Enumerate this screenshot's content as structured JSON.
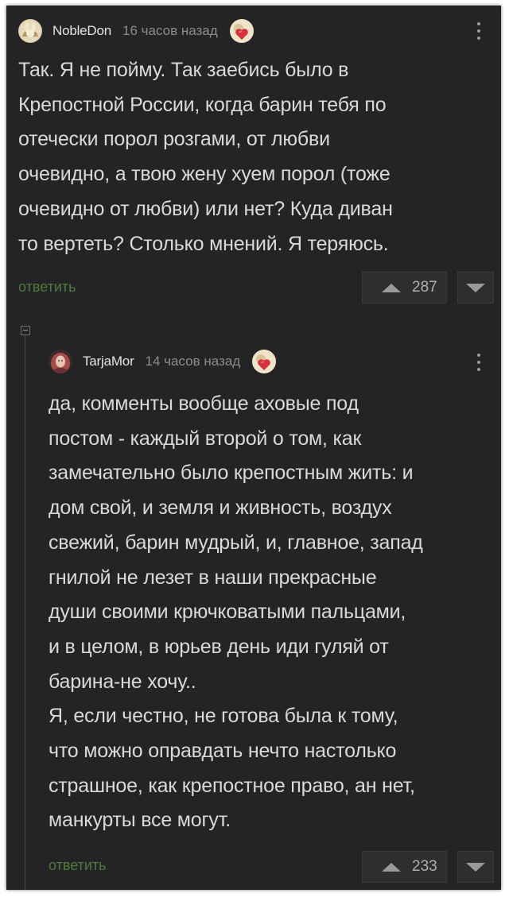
{
  "comments": [
    {
      "username": "NobleDon",
      "timestamp": "16 часов назад",
      "text": "Так. Я не пойму. Так заебись было в\nКрепостной России, когда барин тебя по\nотечески порол розгами, от любви\nочевидно, а твою жену хуем порол (тоже\nочевидно от любви) или нет? Куда диван\nто вертеть? Столько мнений. Я теряюсь.",
      "reply_label": "ответить",
      "score": "287",
      "avatar_icon": "rabbit-avatar-icon",
      "badge_icon": "heart-badge-icon"
    },
    {
      "username": "TarjaMor",
      "timestamp": "14 часов назад",
      "text": "да, комменты вообще аховые под\nпостом - каждый второй о том, как\nзамечательно было крепостным жить: и\nдом свой, и земля и живность, воздух\nсвежий, барин мудрый, и, главное, запад\nгнилой не лезет в наши прекрасные\nдуши своими крючковатыми пальцами,\nи в целом, в юрьев день иди гуляй от\nбарина-не хочу..\nЯ, если честно, не готова была к тому,\nчто можно оправдать нечто настолько\nстрашное, как крепостное право, ан нет,\nманкурты все могут.",
      "reply_label": "ответить",
      "score": "233",
      "avatar_icon": "woman-portrait-avatar-icon",
      "badge_icon": "heart-badge-icon"
    }
  ],
  "colors": {
    "background": "#242426",
    "reply_link": "#4f7a3c",
    "text": "#d9d9d9",
    "muted": "#8c8c8c"
  }
}
